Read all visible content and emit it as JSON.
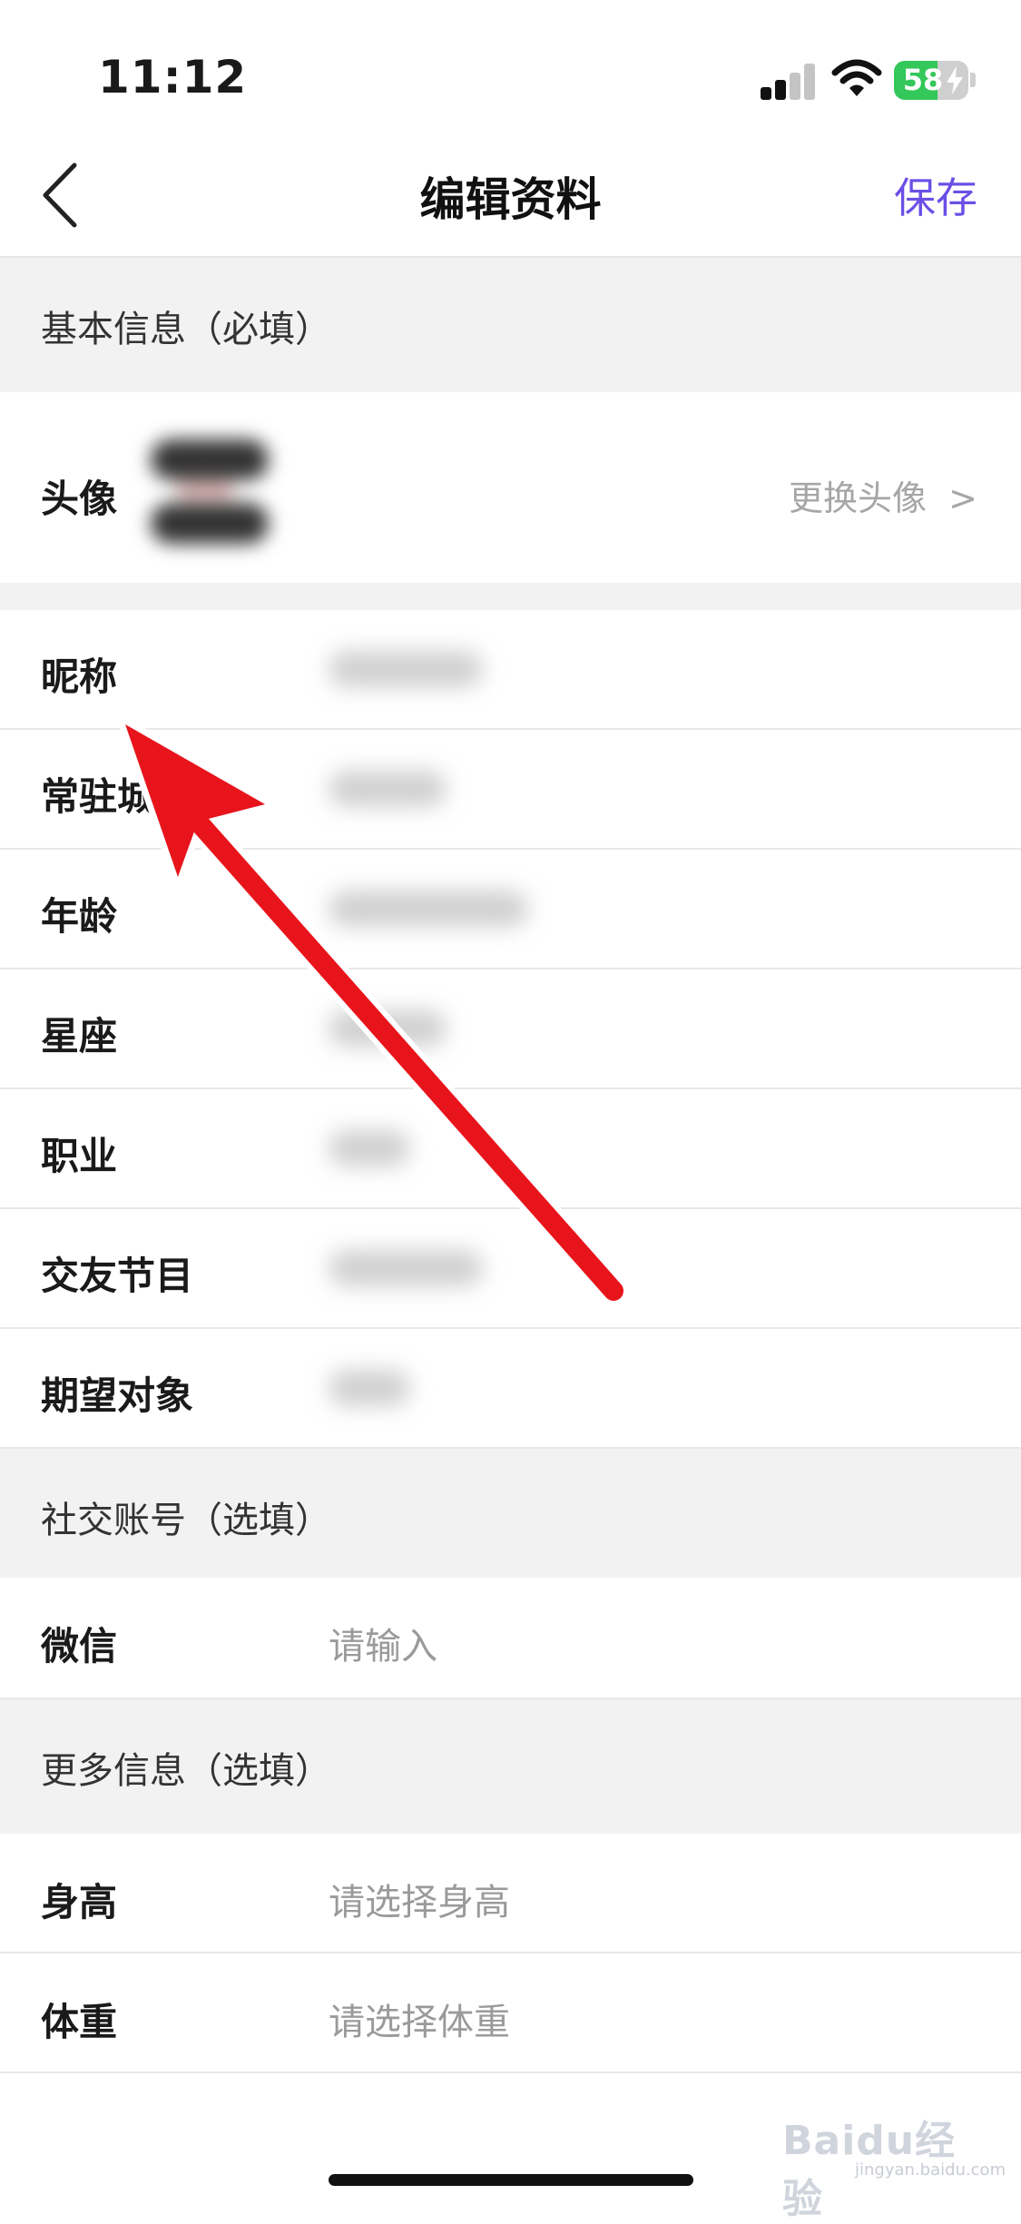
{
  "status_bar": {
    "time": "11:12",
    "battery": "58",
    "battery_color": "#34c759"
  },
  "nav": {
    "back_icon": "chevron-left-icon",
    "title": "编辑资料",
    "save_label": "保存",
    "save_color": "#6b4fe6"
  },
  "sections": {
    "basic": "基本信息（必填）",
    "social": "社交账号（选填）",
    "more": "更多信息（选填）"
  },
  "avatar_row": {
    "label": "头像",
    "action": "更换头像",
    "chevron": ">"
  },
  "basic_fields": [
    {
      "label": "昵称"
    },
    {
      "label": "常驻城市"
    },
    {
      "label": "年龄"
    },
    {
      "label": "星座"
    },
    {
      "label": "职业"
    },
    {
      "label": "交友节目"
    },
    {
      "label": "期望对象"
    }
  ],
  "social_fields": [
    {
      "label": "微信",
      "placeholder": "请输入"
    }
  ],
  "more_fields": [
    {
      "label": "身高",
      "placeholder": "请选择身高"
    },
    {
      "label": "体重",
      "placeholder": "请选择体重"
    }
  ],
  "annotation": {
    "arrow_color": "#e8141c"
  },
  "watermark": {
    "text": "Baidu经验",
    "sub": "jingyan.baidu.com"
  }
}
